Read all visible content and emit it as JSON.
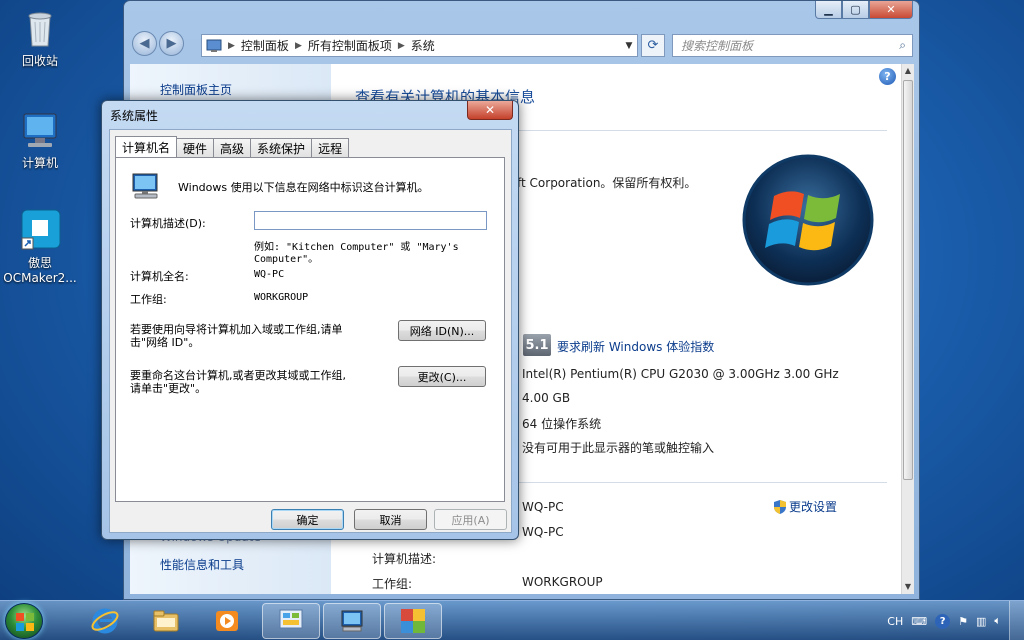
{
  "desktop": {
    "icons": [
      {
        "label": "回收站",
        "icon": "recycle-bin-icon"
      },
      {
        "label": "计算机",
        "icon": "computer-icon"
      },
      {
        "label": "傲思",
        "label2": "OCMaker2...",
        "icon": "ocmaker-shortcut-icon"
      }
    ]
  },
  "control_panel": {
    "address": {
      "crumbs": [
        "控制面板",
        "所有控制面板项",
        "系统"
      ]
    },
    "search_placeholder": "搜索控制面板",
    "left": {
      "home": "控制面板主页",
      "bottom_links": [
        "Windows Update",
        "性能信息和工具"
      ]
    },
    "main": {
      "title": "查看有关计算机的基本信息",
      "copyright": "ft Corporation。保留所有权利。",
      "rating": {
        "score": "5.1",
        "link": "要求刷新 Windows 体验指数"
      },
      "processor": "Intel(R) Pentium(R) CPU G2030 @ 3.00GHz   3.00 GHz",
      "memory": "4.00 GB",
      "system_type": "64 位操作系统",
      "pen_touch": "没有可用于此显示器的笔或触控输入",
      "computer_name": "WQ-PC",
      "full_name": "WQ-PC",
      "description_label": "计算机描述:",
      "workgroup_label": "工作组:",
      "workgroup_value": "WORKGROUP",
      "change_settings": "更改设置"
    }
  },
  "dialog": {
    "title": "系统属性",
    "close": "✕",
    "tabs": [
      "计算机名",
      "硬件",
      "高级",
      "系统保护",
      "远程"
    ],
    "intro": "Windows 使用以下信息在网络中标识这台计算机。",
    "desc_label": "计算机描述(D):",
    "desc_value": "",
    "example_line1": "例如: \"Kitchen Computer\" 或 \"Mary's",
    "example_line2": "Computer\"。",
    "full_name_label": "计算机全名:",
    "full_name_value": "WQ-PC",
    "workgroup_label": "工作组:",
    "workgroup_value": "WORKGROUP",
    "network_text_1": "若要使用向导将计算机加入域或工作组,请单",
    "network_text_2": "击\"网络 ID\"。",
    "network_button": "网络 ID(N)...",
    "rename_text_1": "要重命名这台计算机,或者更改其域或工作组,",
    "rename_text_2": "请单击\"更改\"。",
    "change_button": "更改(C)...",
    "ok": "确定",
    "cancel": "取消",
    "apply": "应用(A)"
  },
  "taskbar": {
    "lang": "CH"
  }
}
